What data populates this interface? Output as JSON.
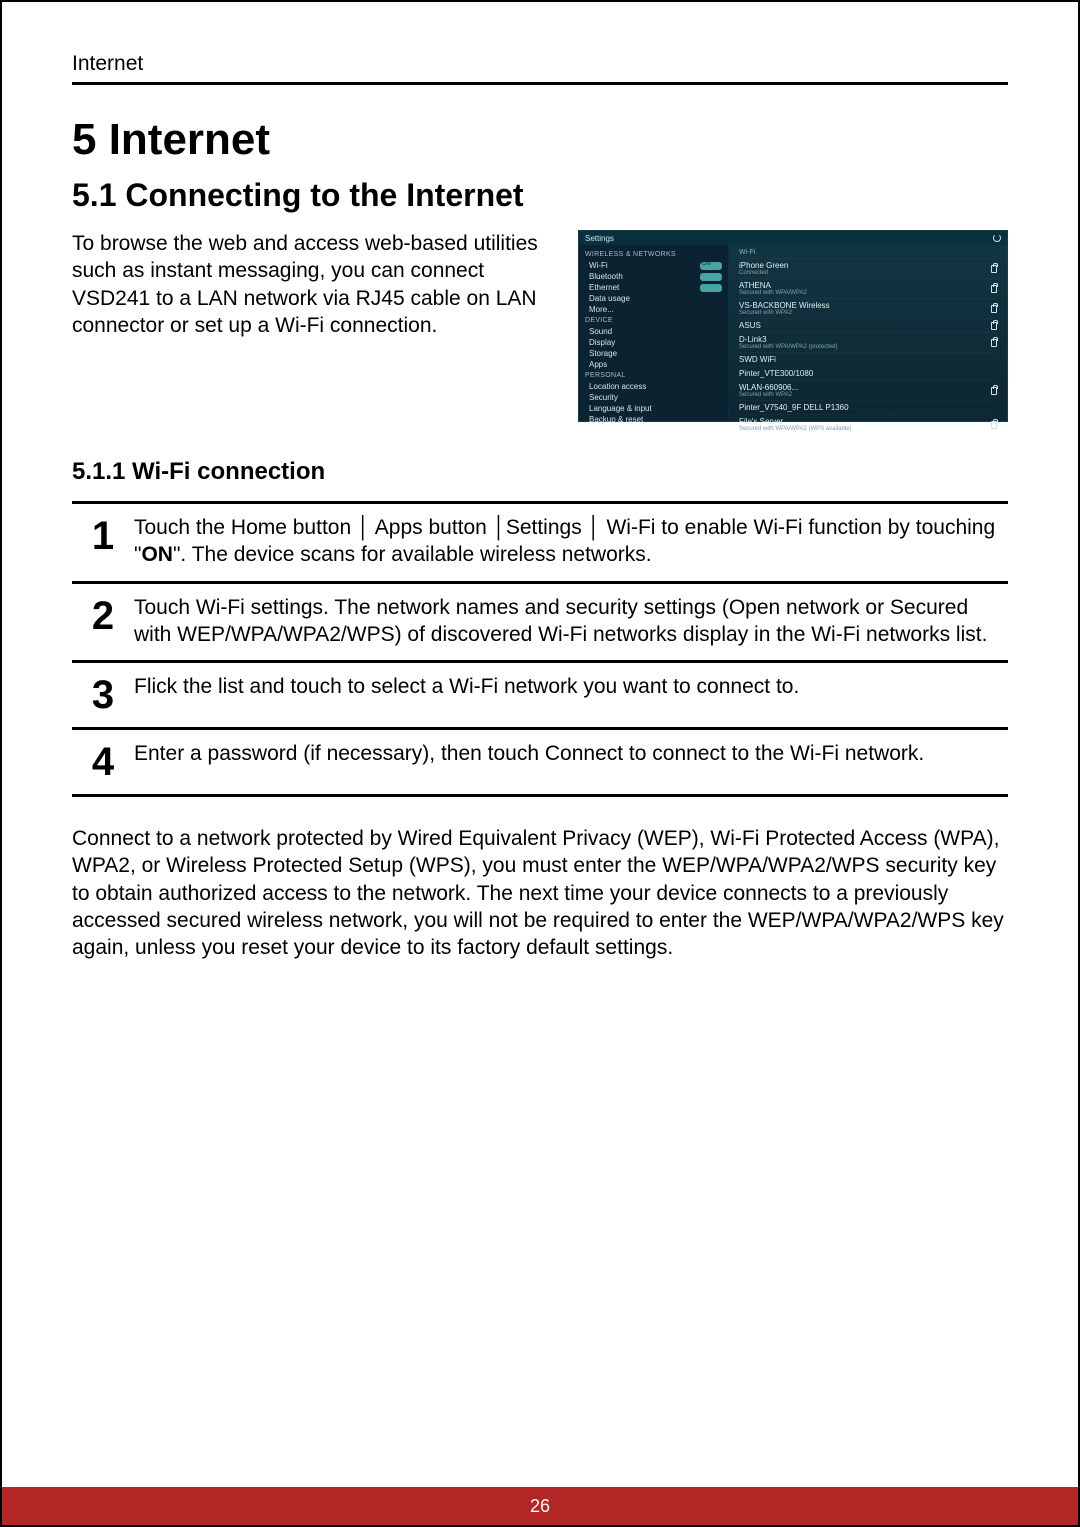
{
  "running_head": "Internet",
  "h1": "5 Internet",
  "h2": "5.1  Connecting to the Internet",
  "intro": "To browse the web and access web-based utilities such as instant messaging, you can connect VSD241 to a LAN network via RJ45 cable on LAN connector or set up a Wi-Fi connection.",
  "h3": "5.1.1  Wi-Fi connection",
  "steps": [
    {
      "num": "1",
      "before": "Touch the Home button │ Apps button │Settings │ Wi-Fi to enable Wi-Fi function by touching \"",
      "bold": "ON",
      "after": "\". The device scans for available wireless networks."
    },
    {
      "num": "2",
      "text": "Touch Wi-Fi settings. The network names and security settings (Open network or Secured with WEP/WPA/WPA2/WPS) of discovered Wi-Fi networks display in the Wi-Fi networks list."
    },
    {
      "num": "3",
      "text": "Flick the list and touch to select a Wi-Fi network you want to connect to."
    },
    {
      "num": "4",
      "text": "Enter a password (if necessary), then touch Connect to connect to the Wi-Fi network."
    }
  ],
  "after": "Connect to a network protected by Wired Equivalent Privacy (WEP), Wi-Fi Protected Access (WPA), WPA2, or Wireless Protected Setup (WPS), you must enter the WEP/WPA/WPA2/WPS security key to obtain authorized access to the network. The next time your device connects to a previously accessed secured wireless network, you will not be required to enter the WEP/WPA/WPA2/WPS key again, unless you reset your device to its factory default settings.",
  "page_number": "26",
  "screenshot": {
    "title": "Settings",
    "left": {
      "section1": "WIRELESS & NETWORKS",
      "items1": [
        {
          "label": "Wi-Fi",
          "toggle": "on"
        },
        {
          "label": "Bluetooth",
          "toggle": "off"
        },
        {
          "label": "Ethernet",
          "toggle": "off"
        },
        {
          "label": "Data usage"
        },
        {
          "label": "More..."
        }
      ],
      "section2": "DEVICE",
      "items2": [
        {
          "label": "Sound"
        },
        {
          "label": "Display"
        },
        {
          "label": "Storage"
        },
        {
          "label": "Apps"
        }
      ],
      "section3": "PERSONAL",
      "items3": [
        {
          "label": "Location access"
        },
        {
          "label": "Security"
        },
        {
          "label": "Language & input"
        },
        {
          "label": "Backup & reset"
        }
      ]
    },
    "right": {
      "header": "Wi-Fi",
      "rows": [
        {
          "title": "iPhone Green",
          "sub": "Connected",
          "lock": true
        },
        {
          "title": "ATHENA",
          "sub": "Secured with WPA/WPA2",
          "lock": true
        },
        {
          "title": "VS-BACKBONE Wireless",
          "sub": "Secured with WPA2",
          "lock": true
        },
        {
          "title": "ASUS",
          "sub": "",
          "lock": true
        },
        {
          "title": "D-Link3",
          "sub": "Secured with WPA/WPA2 (protected)",
          "lock": true
        },
        {
          "title": "SWD WiFi",
          "sub": "",
          "lock": false
        },
        {
          "title": "Pinter_VTE300/1080",
          "sub": "",
          "lock": false
        },
        {
          "title": "WLAN-660906...",
          "sub": "Secured with WPA2",
          "lock": true
        },
        {
          "title": "Pinter_V7540_9F DELL P1360",
          "sub": "",
          "lock": false
        },
        {
          "title": "File's Server",
          "sub": "Secured with WPA/WPA2 (WPS available)",
          "lock": true
        }
      ]
    }
  }
}
